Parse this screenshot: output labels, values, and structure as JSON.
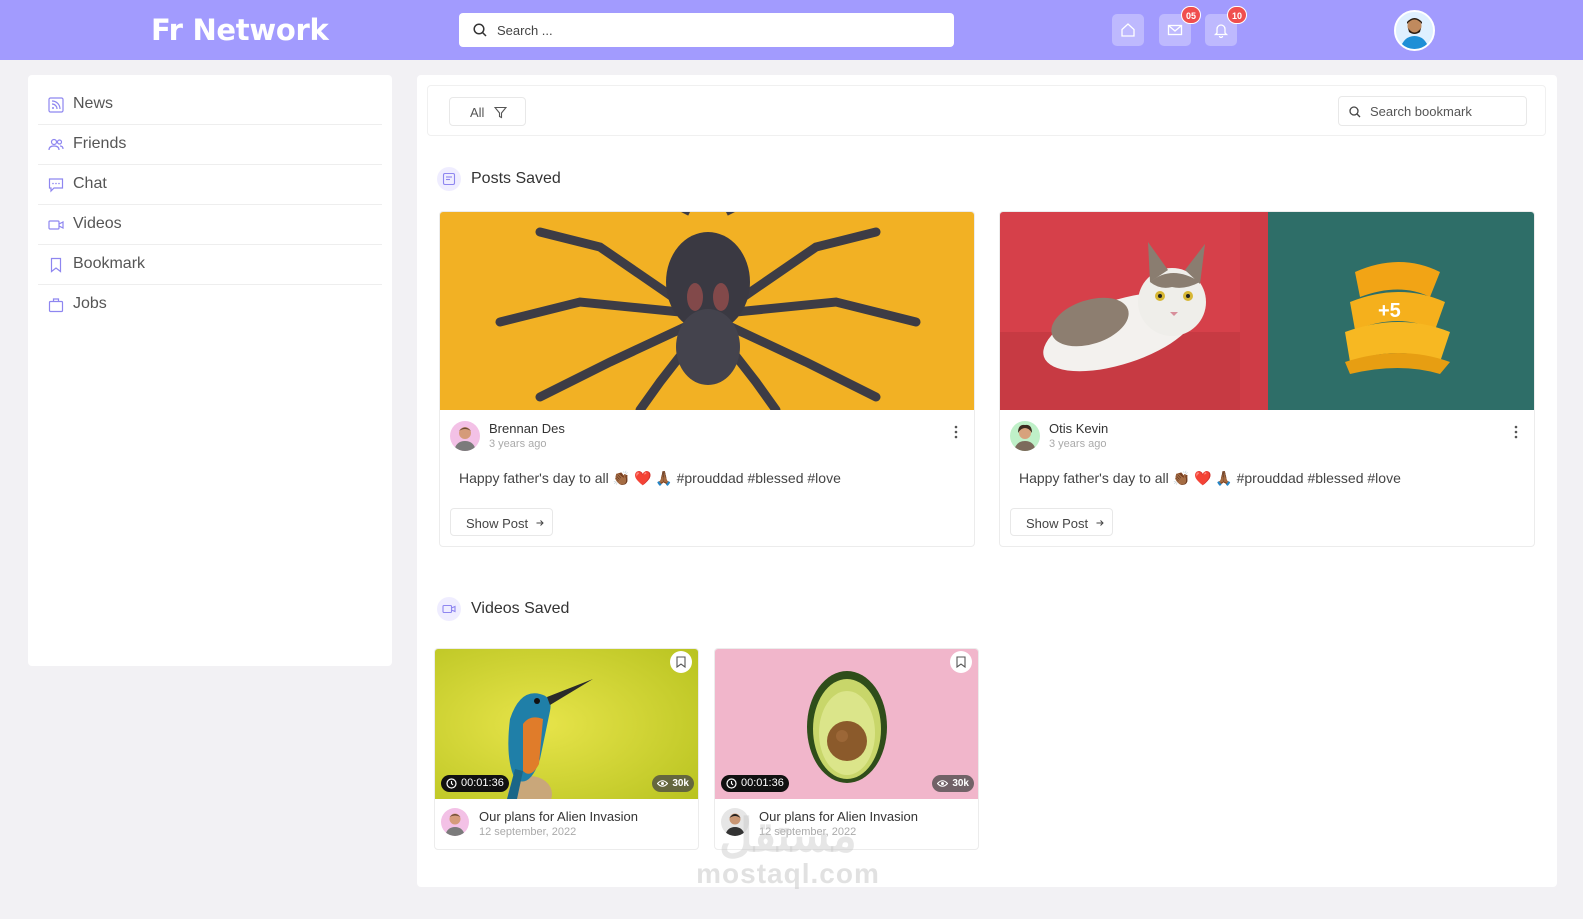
{
  "header": {
    "brand": "Fr Network",
    "search_placeholder": "Search ...",
    "messages_badge": "05",
    "notifications_badge": "10"
  },
  "sidebar": {
    "items": [
      {
        "label": "News",
        "icon": "rss-icon"
      },
      {
        "label": "Friends",
        "icon": "users-icon"
      },
      {
        "label": "Chat",
        "icon": "chat-icon"
      },
      {
        "label": "Videos",
        "icon": "video-icon"
      },
      {
        "label": "Bookmark",
        "icon": "bookmark-icon"
      },
      {
        "label": "Jobs",
        "icon": "briefcase-icon"
      }
    ]
  },
  "toolbar": {
    "filter_label": "All",
    "search_placeholder": "Search bookmark"
  },
  "posts_section": {
    "title": "Posts Saved",
    "posts": [
      {
        "author": "Brennan Des",
        "time": "3 years ago",
        "text": "Happy father's day to all 👏🏾 ❤️ 🙏🏾 #prouddad #blessed #love",
        "button": "Show Post",
        "image": "tarantula on yellow background"
      },
      {
        "author": "Otis Kevin",
        "time": "3 years ago",
        "text": "Happy father's day to all 👏🏾 ❤️ 🙏🏾 #prouddad #blessed #love",
        "button": "Show Post",
        "image": "cat on red sofa",
        "more_count": "+5"
      }
    ]
  },
  "videos_section": {
    "title": "Videos Saved",
    "videos": [
      {
        "title": "Our plans for Alien Invasion",
        "date": "12 september, 2022",
        "duration": "00:01:36",
        "views": "30k",
        "image": "kingfisher bird"
      },
      {
        "title": "Our plans for Alien Invasion",
        "date": "12 september, 2022",
        "duration": "00:01:36",
        "views": "30k",
        "image": "avocado on pink"
      }
    ]
  },
  "watermark": {
    "logo": "مستقل",
    "text": "mostaql.com"
  },
  "colors": {
    "accent": "#a29bfe",
    "badge": "#f04e4e",
    "background": "#f2f1f4"
  }
}
